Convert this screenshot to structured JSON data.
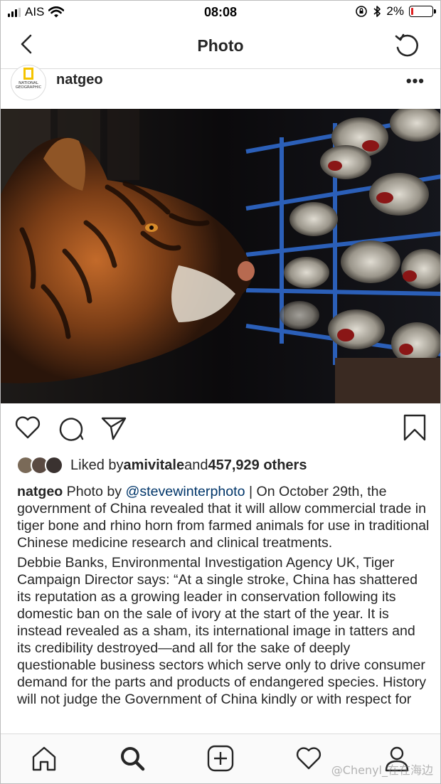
{
  "status_bar": {
    "carrier": "AIS",
    "time": "08:08",
    "battery_percent": "2%",
    "battery_level": 0.02
  },
  "nav": {
    "title": "Photo",
    "back_icon": "chevron-left-icon",
    "refresh_icon": "refresh-icon"
  },
  "post": {
    "username": "natgeo",
    "avatar_text": "NATIONAL GEOGRAPHIC",
    "more_label": "•••",
    "likes": {
      "prefix": "Liked by ",
      "user": "amivitale",
      "middle": " and ",
      "count": "457,929 others"
    },
    "caption": {
      "username": "natgeo",
      "lead": " Photo by ",
      "mention": "@stevewinterphoto",
      "paragraph1": " | On October 29th, the government of China revealed that it will allow commercial trade in tiger bone and rhino horn from farmed animals for use in traditional Chinese medicine research and clinical treatments.",
      "paragraph2": "Debbie Banks, Environmental Investigation Agency UK, Tiger Campaign Director says: “At a single stroke, China has shattered its reputation as a growing leader in conservation following its domestic ban on the sale of ivory at the start of the year. It is instead revealed as a sham, its international image in tatters and its credibility destroyed—and all for the sake of deeply questionable business sectors which serve only to drive consumer demand for the parts and products of endangered species. History will not judge the Government of China kindly or with respect for"
    }
  },
  "tabs": [
    {
      "icon": "home-icon"
    },
    {
      "icon": "search-icon"
    },
    {
      "icon": "add-post-icon"
    },
    {
      "icon": "heart-icon"
    },
    {
      "icon": "profile-icon"
    }
  ],
  "watermark": "@Chenyl_在在海边",
  "colors": {
    "text": "#262626",
    "mention": "#003569",
    "divider": "#dbdbdb",
    "battery_low": "#e02020",
    "natgeo_yellow": "#f5c400"
  }
}
